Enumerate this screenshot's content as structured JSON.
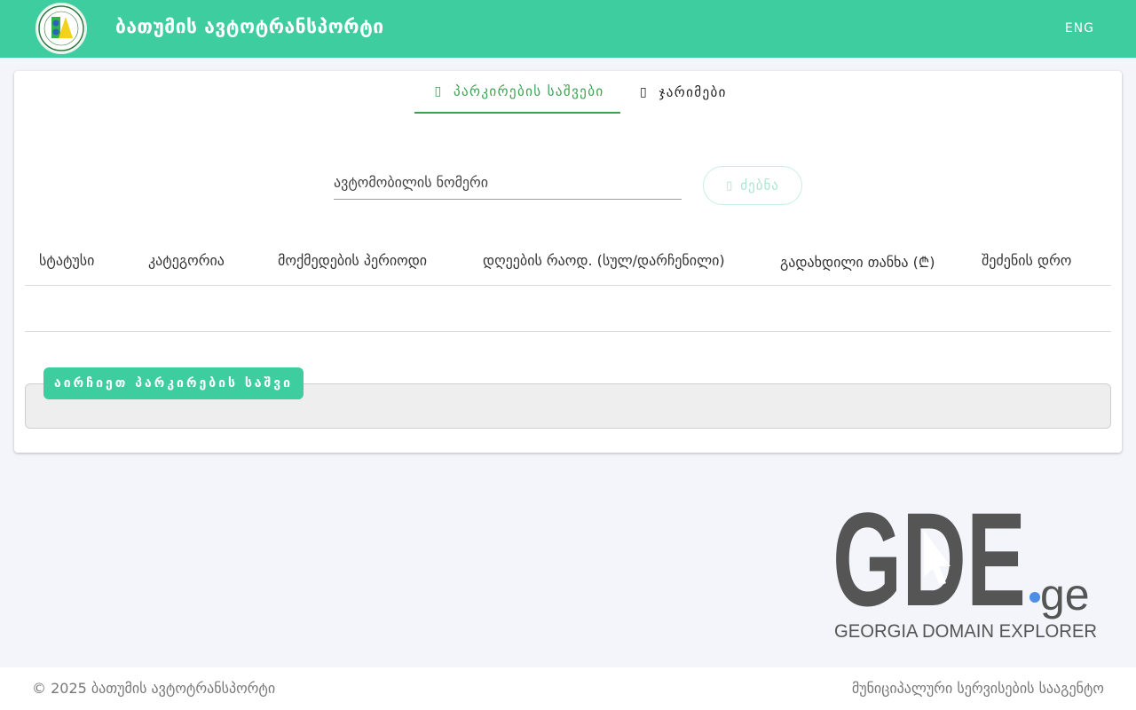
{
  "header": {
    "title": "ბათუმის ავტოტრანსპორტი",
    "lang_label": "ENG",
    "brand_color": "#3ecd9e"
  },
  "tabs": [
    {
      "label": "პარკირების საშვები",
      "icon": "parking-icon",
      "active": true
    },
    {
      "label": "ჯარიმები",
      "icon": "fines-icon",
      "active": false
    }
  ],
  "search": {
    "placeholder": "ავტომობილის ნომერი",
    "value": "",
    "button_label": "ძებნა",
    "button_icon": "search-icon"
  },
  "table": {
    "columns": [
      "სტატუსი",
      "კატეგორია",
      "მოქმედების პერიოდი",
      "დღეების რაოდ. (სულ/დარჩენილი)",
      "გადახდილი თანხა (₾)",
      "შეძენის დრო"
    ],
    "rows": []
  },
  "pass_select": {
    "label": "აირჩიეთ პარკირების საშვი"
  },
  "watermark": {
    "logo_text": "GDE",
    "domain_suffix": ".ge",
    "tagline": "GEORGIA DOMAIN EXPLORER"
  },
  "footer": {
    "copyright": "© 2025 ბათუმის ავტოტრანსპორტი",
    "agency": "მუნიციპალური სერვისების სააგენტო"
  }
}
